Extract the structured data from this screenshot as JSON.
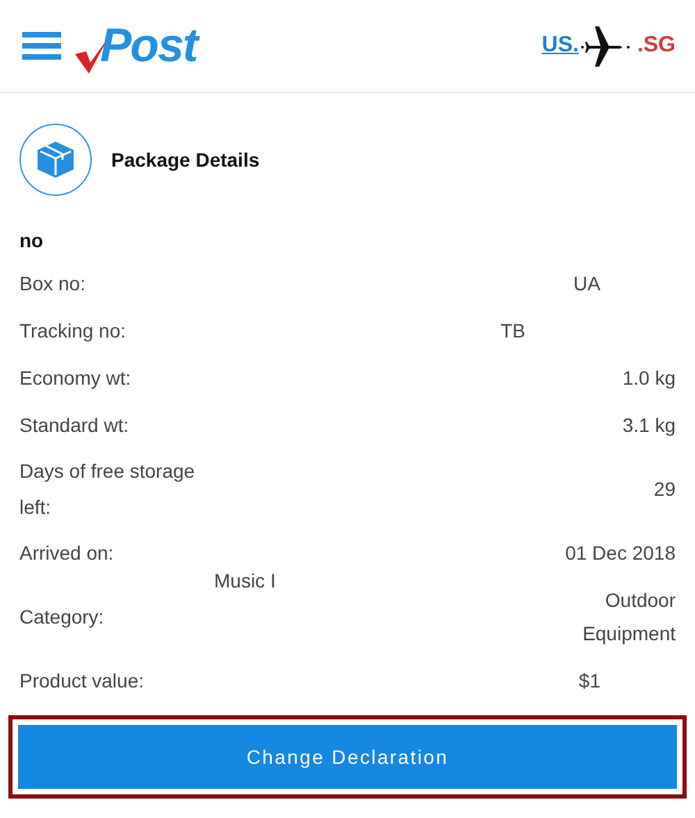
{
  "header": {
    "logo": "Post",
    "origin": "US.",
    "destination": ".SG"
  },
  "section": {
    "title": "Package Details"
  },
  "package_name": "no",
  "details": [
    {
      "label": "Box no:",
      "values": [
        "UA"
      ],
      "kind": "masked"
    },
    {
      "label": "Tracking no:",
      "values": [
        "TB"
      ],
      "kind": "masked-wide"
    },
    {
      "label": "Economy wt:",
      "values": [
        "1.0 kg"
      ],
      "kind": "plain"
    },
    {
      "label": "Standard wt:",
      "values": [
        "3.1 kg"
      ],
      "kind": "plain"
    },
    {
      "label": "Days of free storage left:",
      "values": [
        "29"
      ],
      "kind": "plain"
    },
    {
      "label": "Arrived on:",
      "values": [
        "01 Dec 2018"
      ],
      "kind": "plain"
    },
    {
      "label": "Category:",
      "values": [
        "Music I",
        "Outdoor Equipment"
      ],
      "kind": "split"
    },
    {
      "label": "Product value:",
      "values": [
        "$1"
      ],
      "kind": "masked"
    }
  ],
  "button": {
    "label": "Change Declaration",
    "focused": true
  }
}
